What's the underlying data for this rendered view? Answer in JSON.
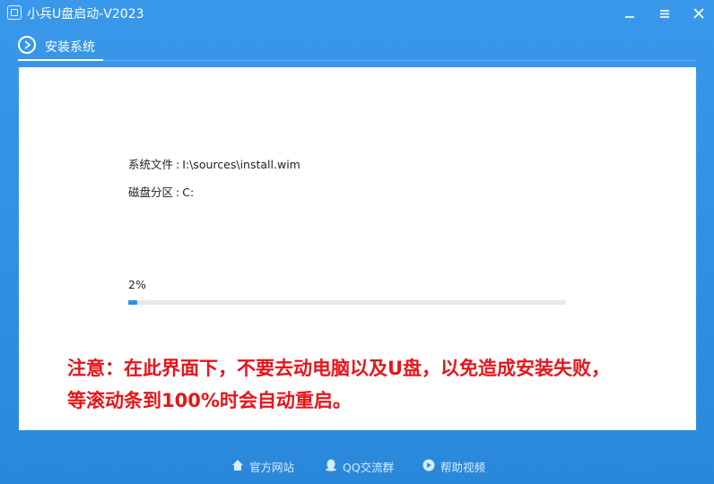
{
  "window": {
    "title": "小兵U盘启动-V2023",
    "buttons": {
      "minimize": "minimize-icon",
      "menu": "menu-icon",
      "close": "close-icon"
    }
  },
  "tabs": [
    {
      "label": "安装系统",
      "icon": "chevron-right-icon",
      "active": true
    }
  ],
  "install": {
    "system_file_label": "系统文件",
    "system_file_value": "I:\\sources\\install.wim",
    "partition_label": "磁盘分区",
    "partition_value": "C:",
    "separator": ":",
    "progress_text": "2%",
    "progress_fraction": 0.02
  },
  "warning": {
    "line1": "注意：在此界面下，不要去动电脑以及U盘，以免造成安装失败，",
    "line2": "等滚动条到100%时会自动重启。"
  },
  "footer": {
    "links": [
      {
        "label": "官方网站",
        "icon": "home-icon"
      },
      {
        "label": "QQ交流群",
        "icon": "qq-icon"
      },
      {
        "label": "帮助视频",
        "icon": "play-icon"
      }
    ]
  },
  "colors": {
    "background": "#2f8fe0",
    "panel": "#ffffff",
    "progress": "#2f8fe0",
    "warning": "#e8141a"
  }
}
